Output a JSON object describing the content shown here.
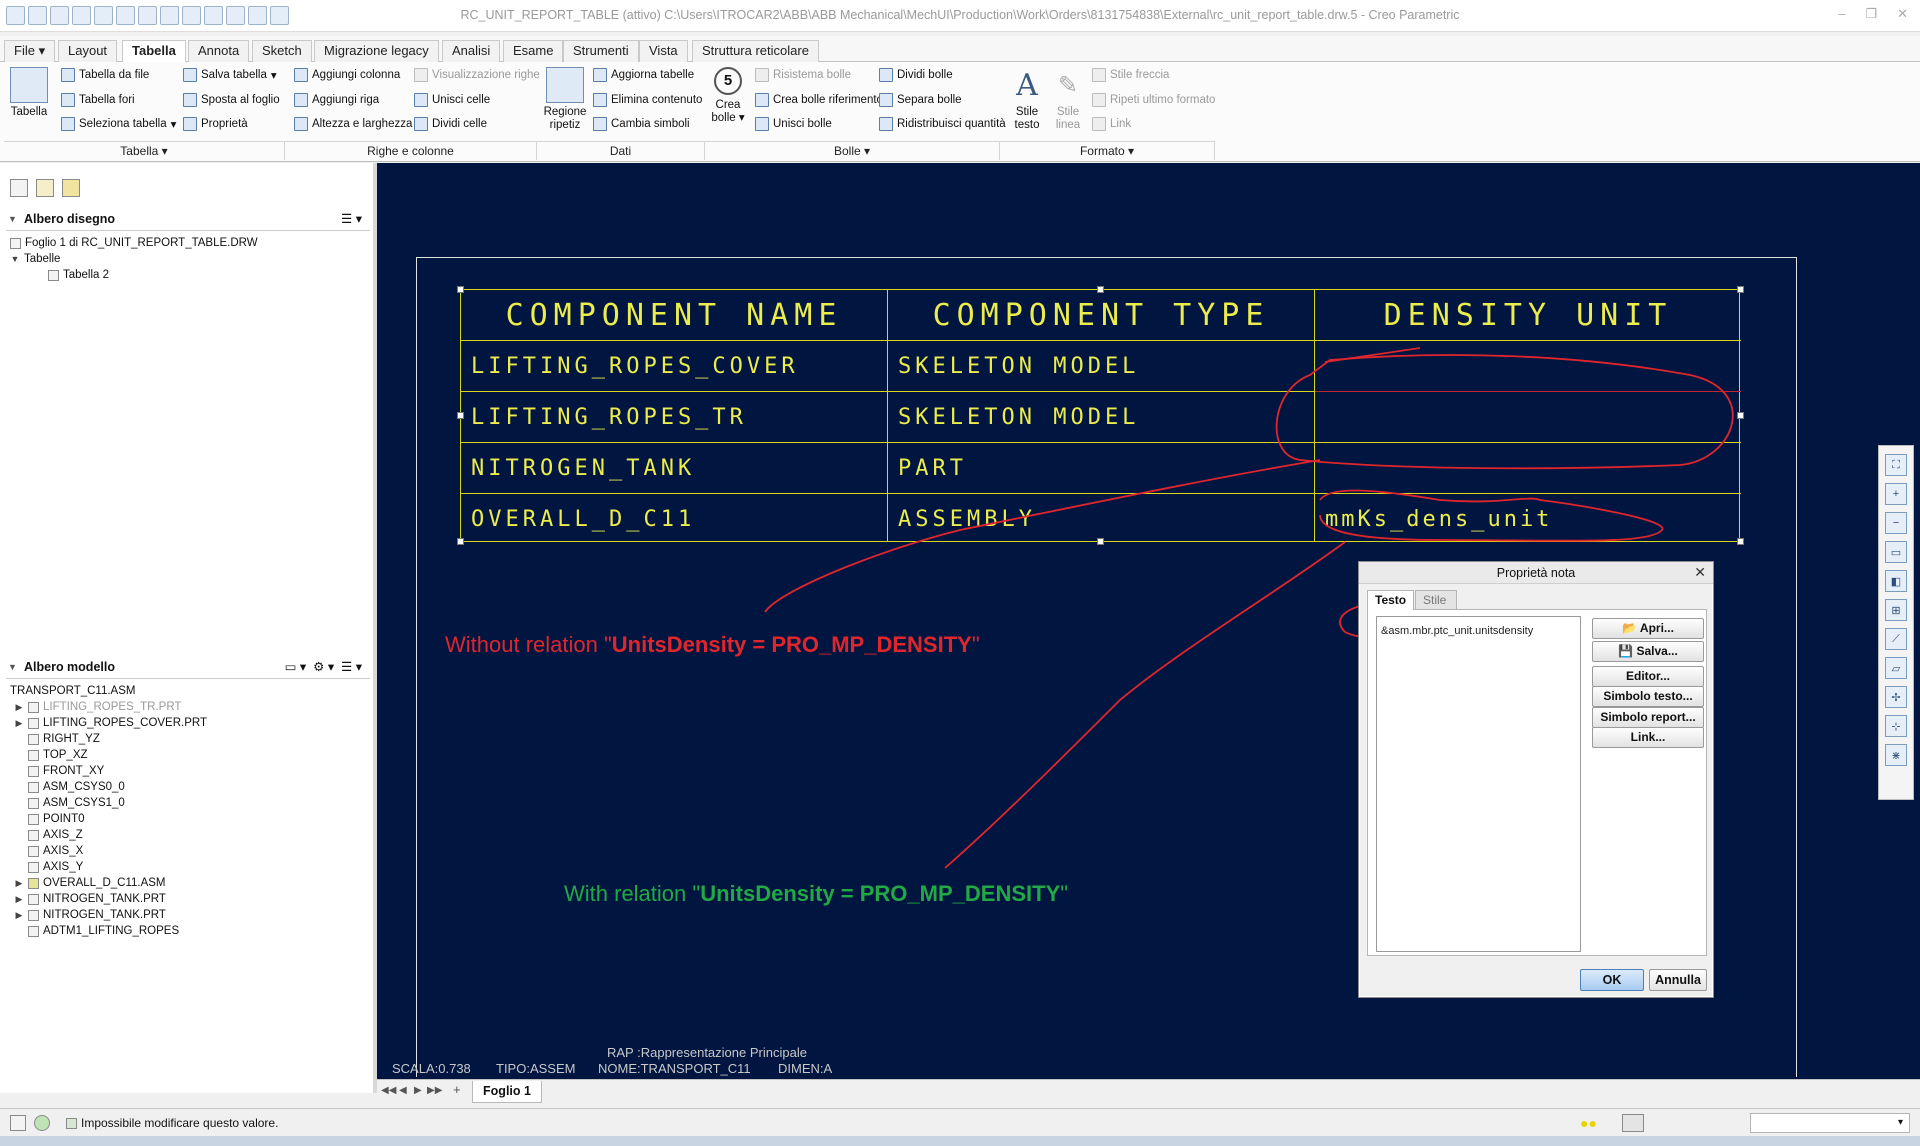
{
  "window": {
    "title": "RC_UNIT_REPORT_TABLE (attivo) C:\\Users\\ITROCAR2\\ABB\\ABB Mechanical\\MechUI\\Production\\Work\\Orders\\8131754838\\External\\rc_unit_report_table.drw.5 - Creo Parametric"
  },
  "menu_tabs": [
    "File",
    "Layout",
    "Tabella",
    "Annota",
    "Sketch",
    "Migrazione legacy",
    "Analisi",
    "Esame",
    "Strumenti",
    "Vista",
    "Struttura reticolare"
  ],
  "active_tab": "Tabella",
  "ribbon": {
    "tabella": {
      "big": "Tabella",
      "b1": "Tabella da file",
      "b2": "Tabella fori",
      "b3": "Seleziona tabella",
      "b4": "Salva tabella",
      "b5": "Sposta al foglio",
      "b6": "Proprietà",
      "group": "Tabella"
    },
    "righe": {
      "b1": "Aggiungi colonna",
      "b2": "Aggiungi riga",
      "b3": "Altezza e larghezza",
      "b4": "Visualizzazione righe",
      "b5": "Unisci celle",
      "b6": "Dividi celle",
      "group": "Righe e colonne"
    },
    "dati": {
      "big1": "Regione",
      "big2": "ripetiz",
      "b1": "Aggiorna tabelle",
      "b2": "Elimina contenuto",
      "b3": "Cambia simboli",
      "group": "Dati"
    },
    "bolle": {
      "big_num": "5",
      "big1": "Crea",
      "big2": "bolle",
      "b1": "Risistema bolle",
      "b2": "Crea bolle riferimento",
      "b3": "Unisci bolle",
      "b4": "Dividi bolle",
      "b5": "Separa bolle",
      "b6": "Ridistribuisci quantità",
      "group": "Bolle"
    },
    "formato": {
      "s1a": "Stile",
      "s1b": "testo",
      "s2a": "Stile",
      "s2b": "linea",
      "b1": "Stile freccia",
      "b2": "Ripeti ultimo formato",
      "b3": "Link",
      "group": "Formato"
    }
  },
  "drawing_tree": {
    "header": "Albero disegno",
    "items": [
      "Foglio 1 di RC_UNIT_REPORT_TABLE.DRW",
      "Tabelle",
      "Tabella 2"
    ]
  },
  "model_tree": {
    "header": "Albero modello",
    "items": [
      "TRANSPORT_C11.ASM",
      "LIFTING_ROPES_TR.PRT",
      "LIFTING_ROPES_COVER.PRT",
      "RIGHT_YZ",
      "TOP_XZ",
      "FRONT_XY",
      "ASM_CSYS0_0",
      "ASM_CSYS1_0",
      "POINT0",
      "AXIS_Z",
      "AXIS_X",
      "AXIS_Y",
      "OVERALL_D_C11.ASM",
      "NITROGEN_TANK.PRT",
      "NITROGEN_TANK.PRT",
      "ADTM1_LIFTING_ROPES"
    ]
  },
  "drawing_table": {
    "headers": [
      "COMPONENT NAME",
      "COMPONENT TYPE",
      "DENSITY UNIT"
    ],
    "rows": [
      [
        "LIFTING_ROPES_COVER",
        "SKELETON MODEL",
        ""
      ],
      [
        "LIFTING_ROPES_TR",
        "SKELETON MODEL",
        ""
      ],
      [
        "NITROGEN_TANK",
        "PART",
        ""
      ],
      [
        "OVERALL_D_C11",
        "ASSEMBLY",
        "mmKs_dens_unit"
      ]
    ]
  },
  "annotations": {
    "red_prefix": "Without relation \"",
    "red_bold": "UnitsDensity = PRO_MP_DENSITY",
    "red_suffix": "\"",
    "green_prefix": "With relation \"",
    "green_bold": "UnitsDensity = PRO_MP_DENSITY",
    "green_suffix": "\"",
    "red_color": "#e0262d",
    "green_color": "#22a845"
  },
  "sheet_footer": {
    "rap": "RAP :Rappresentazione Principale",
    "scala": "SCALA:0.738",
    "tipo": "TIPO:ASSEM",
    "nome": "NOME:TRANSPORT_C11",
    "dimen": "DIMEN:A"
  },
  "dialog": {
    "title": "Proprietà nota",
    "tab_text": "Testo",
    "tab_style": "Stile testo",
    "text_value": "&asm.mbr.ptc_unit.unitsdensity",
    "buttons": [
      "Apri...",
      "Salva...",
      "Editor...",
      "Simbolo testo...",
      "Simbolo report...",
      "Link..."
    ],
    "ok": "OK",
    "cancel": "Annulla"
  },
  "sheet_tabs": {
    "sheet": "Foglio 1"
  },
  "status": {
    "message": "Impossibile modificare questo valore."
  },
  "colors": {
    "canvas_bg": "#001540",
    "table_line": "#d8d81a",
    "table_text": "#ecec4c"
  }
}
